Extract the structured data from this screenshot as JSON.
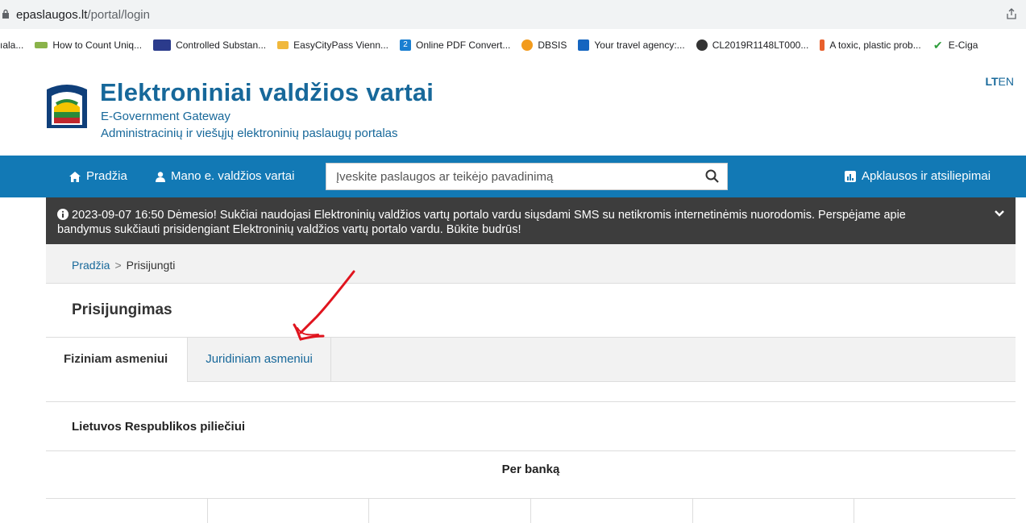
{
  "browser": {
    "url_host": "epaslaugos.lt",
    "url_path": "/portal/login",
    "bookmarks": [
      {
        "label": "ıala...",
        "icon": "none",
        "color": ""
      },
      {
        "label": "How to Count Uniq...",
        "icon": "spreadsheet-icon",
        "color": "#8ab34a"
      },
      {
        "label": "Controlled Substan...",
        "icon": "eu-flag-icon",
        "color": "#2b3b8c"
      },
      {
        "label": "EasyCityPass Vienn...",
        "icon": "easycity-icon",
        "color": "#f0b83c"
      },
      {
        "label": "Online PDF Convert...",
        "icon": "pdf-convert-icon",
        "color": "#1a7fd1"
      },
      {
        "label": "DBSIS",
        "icon": "dbsis-icon",
        "color": "#f29b1d"
      },
      {
        "label": "Your travel agency:...",
        "icon": "travel-icon",
        "color": "#1565c0"
      },
      {
        "label": "CL2019R1148LT000...",
        "icon": "globe-icon",
        "color": "#333333"
      },
      {
        "label": "A toxic, plastic prob...",
        "icon": "toxic-icon",
        "color": "#e85f2c"
      },
      {
        "label": "E-Ciga",
        "icon": "checkmark-icon",
        "color": "#2e9e3c"
      }
    ]
  },
  "header": {
    "title": "Elektroniniai valdžios vartai",
    "subtitle": "E-Government Gateway",
    "tagline": "Administracinių ir viešųjų elektroninių paslaugų portalas",
    "lang_active": "LT",
    "lang_other": "EN"
  },
  "nav": {
    "home": "Pradžia",
    "my_portal": "Mano e. valdžios vartai",
    "search_placeholder": "Įveskite paslaugos ar teikėjo pavadinimą",
    "surveys": "Apklausos ir atsiliepimai"
  },
  "alert": {
    "text": "2023-09-07 16:50  Dėmesio! Sukčiai naudojasi Elektroninių valdžios vartų portalo vardu siųsdami SMS su netikromis internetinėmis nuorodomis. Perspėjame apie bandymus sukčiauti prisidengiant Elektroninių valdžios vartų portalo vardu. Būkite budrūs!"
  },
  "breadcrumb": {
    "home": "Pradžia",
    "separator": ">",
    "current": "Prisijungti"
  },
  "login": {
    "title": "Prisijungimas",
    "tabs": [
      "Fiziniam asmeniui",
      "Juridiniam asmeniui"
    ],
    "section_title": "Lietuvos Respublikos piliečiui",
    "method_title": "Per banką"
  },
  "colors": {
    "brand_blue": "#1279b5",
    "link_blue": "#17689a",
    "alert_bg": "#3d3d3d",
    "annotation_red": "#e0141e"
  }
}
